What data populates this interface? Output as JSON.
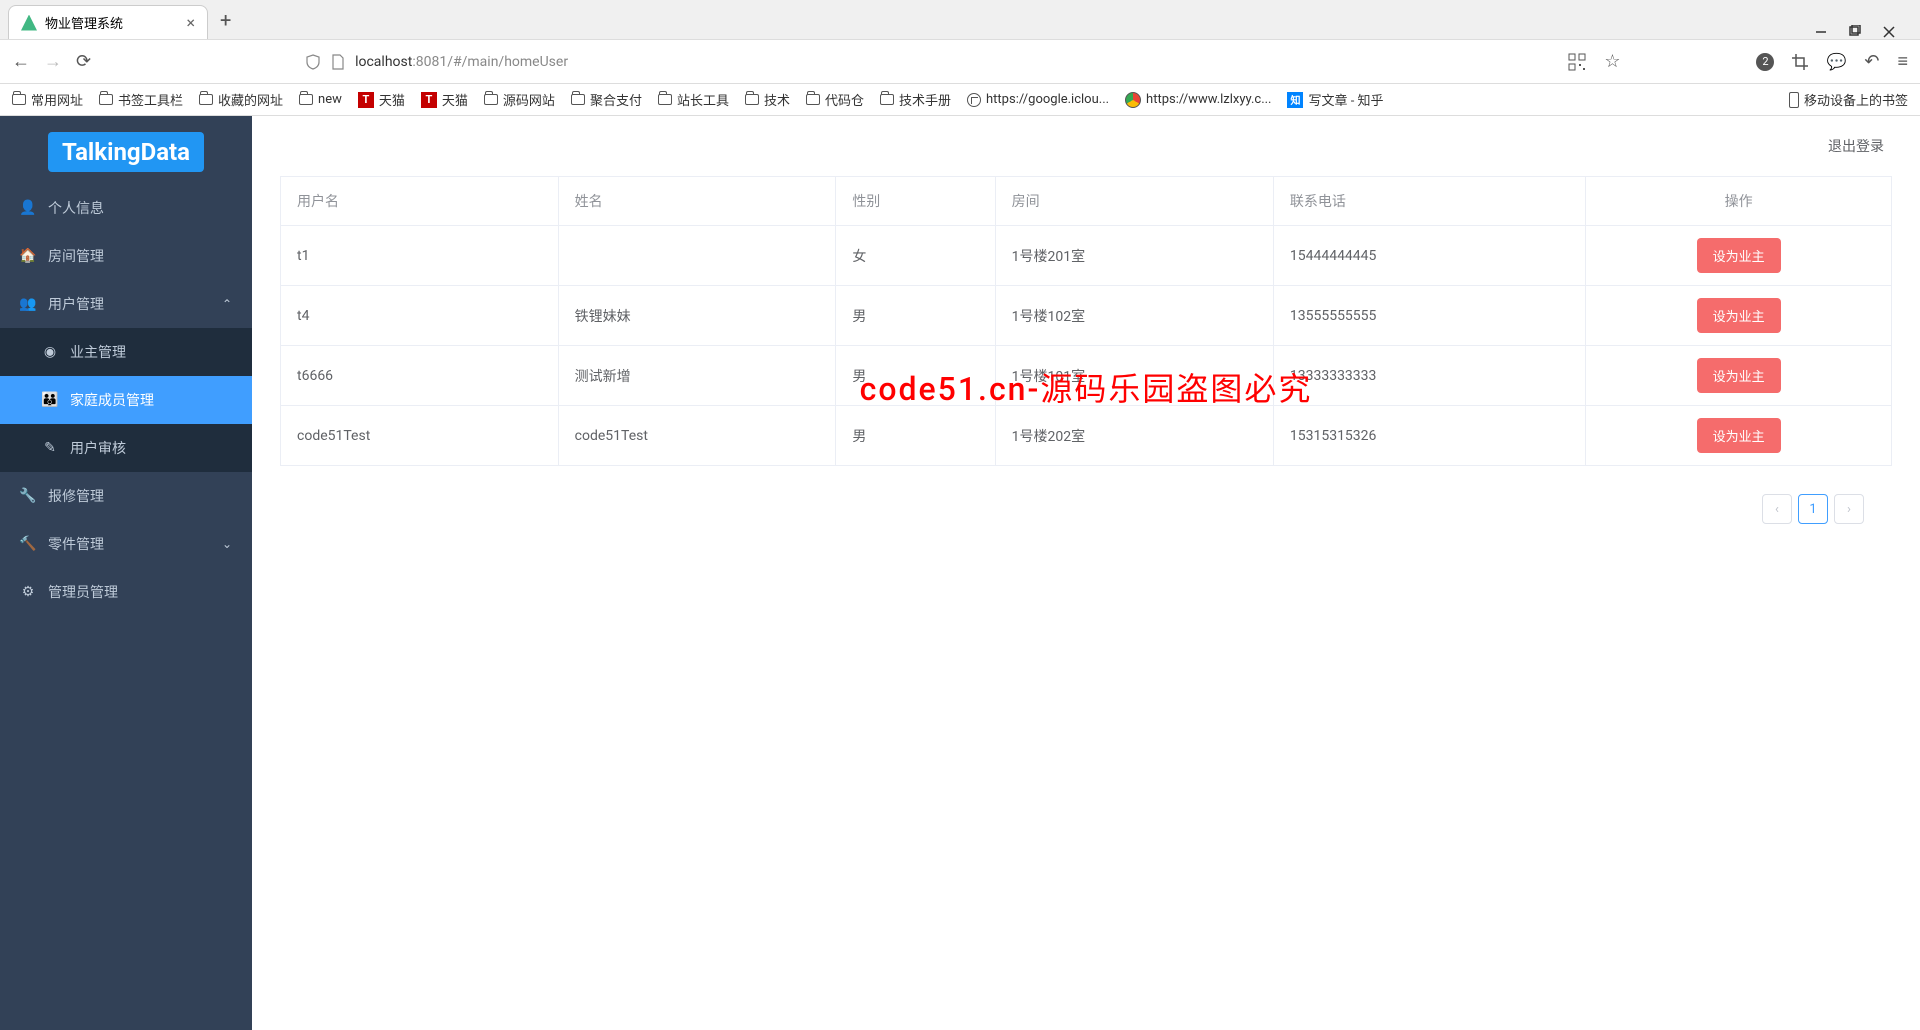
{
  "browser": {
    "tab_title": "物业管理系统",
    "url_prefix": "localhost",
    "url_port": ":8081",
    "url_path": "/#/main/homeUser",
    "badge_count": "2"
  },
  "bookmarks": {
    "b1": "常用网址",
    "b2": "书签工具栏",
    "b3": "收藏的网址",
    "b4": "new",
    "b5": "天猫",
    "b6": "天猫",
    "b7": "源码网站",
    "b8": "聚合支付",
    "b9": "站长工具",
    "b10": "技术",
    "b11": "代码仓",
    "b12": "技术手册",
    "b13": "https://google.iclou...",
    "b14": "https://www.lzlxyy.c...",
    "b15": "写文章 - 知乎",
    "b16": "移动设备上的书签"
  },
  "sidebar": {
    "logo": "TalkingData",
    "m_personal": "个人信息",
    "m_room": "房间管理",
    "m_user": "用户管理",
    "sm_owner": "业主管理",
    "sm_family": "家庭成员管理",
    "sm_audit": "用户审核",
    "m_repair": "报修管理",
    "m_parts": "零件管理",
    "m_admin": "管理员管理"
  },
  "header": {
    "logout": "退出登录"
  },
  "table": {
    "headers": {
      "username": "用户名",
      "name": "姓名",
      "gender": "性别",
      "room": "房间",
      "phone": "联系电话",
      "action": "操作"
    },
    "action_label": "设为业主",
    "rows": [
      {
        "username": "t1",
        "name": "",
        "gender": "女",
        "room": "1号楼201室",
        "phone": "15444444445"
      },
      {
        "username": "t4",
        "name": "铁锂妹妹",
        "gender": "男",
        "room": "1号楼102室",
        "phone": "13555555555"
      },
      {
        "username": "t6666",
        "name": "测试新增",
        "gender": "男",
        "room": "1号楼101室",
        "phone": "13333333333"
      },
      {
        "username": "code51Test",
        "name": "code51Test",
        "gender": "男",
        "room": "1号楼202室",
        "phone": "15315315326"
      }
    ]
  },
  "pagination": {
    "current": "1"
  },
  "watermark": "code51.cn-源码乐园盗图必究"
}
